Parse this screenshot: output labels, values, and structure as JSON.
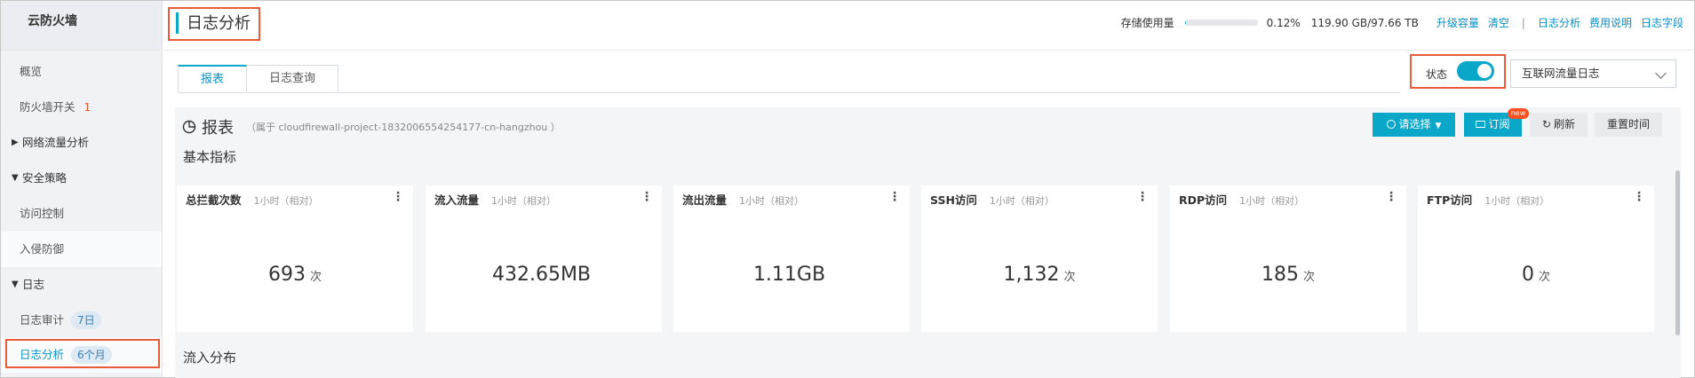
{
  "sidebar": {
    "title": "云防火墙",
    "items": [
      {
        "label": "概览"
      },
      {
        "label": "防火墙开关",
        "badge": "1"
      },
      {
        "label": "网络流量分析"
      },
      {
        "label": "安全策略"
      },
      {
        "label": "访问控制"
      },
      {
        "label": "入侵防御"
      },
      {
        "label": "日志"
      },
      {
        "label": "日志审计",
        "pill": "7日"
      },
      {
        "label": "日志分析",
        "pill": "6个月"
      }
    ]
  },
  "header": {
    "title": "日志分析",
    "storage_label": "存储使用量",
    "storage_percent": 0.12,
    "storage_percent_text": "0.12%",
    "storage_used": "119.90 GB/97.66 TB",
    "links": [
      "升级容量",
      "清空",
      "日志分析",
      "费用说明",
      "日志字段"
    ],
    "separator": "|"
  },
  "tabs": [
    "报表",
    "日志查询"
  ],
  "status": {
    "label": "状态",
    "enabled": true
  },
  "log_type_select": {
    "value": "互联网流量日志"
  },
  "report": {
    "title": "报表",
    "subtitle": "（属于 cloudfirewall-project-1832006554254177-cn-hangzhou ）",
    "buttons": {
      "select": "请选择",
      "subscribe": "订阅",
      "refresh": "刷新",
      "reset_time": "重置时间"
    },
    "new_tag": "new",
    "section_basic": "基本指标",
    "section_inflow": "流入分布",
    "cards": [
      {
        "title": "总拦截次数",
        "range": "1小时（相对）",
        "value": "693",
        "unit": "次"
      },
      {
        "title": "流入流量",
        "range": "1小时（相对）",
        "value": "432.65MB",
        "unit": ""
      },
      {
        "title": "流出流量",
        "range": "1小时（相对）",
        "value": "1.11GB",
        "unit": ""
      },
      {
        "title": "SSH访问",
        "range": "1小时（相对）",
        "value": "1,132",
        "unit": "次"
      },
      {
        "title": "RDP访问",
        "range": "1小时（相对）",
        "value": "185",
        "unit": "次"
      },
      {
        "title": "FTP访问",
        "range": "1小时（相对）",
        "value": "0",
        "unit": "次"
      }
    ]
  },
  "colors": {
    "accent": "#0aa7c9",
    "highlight_box": "#e95c3a",
    "badge": "#e8582d"
  }
}
